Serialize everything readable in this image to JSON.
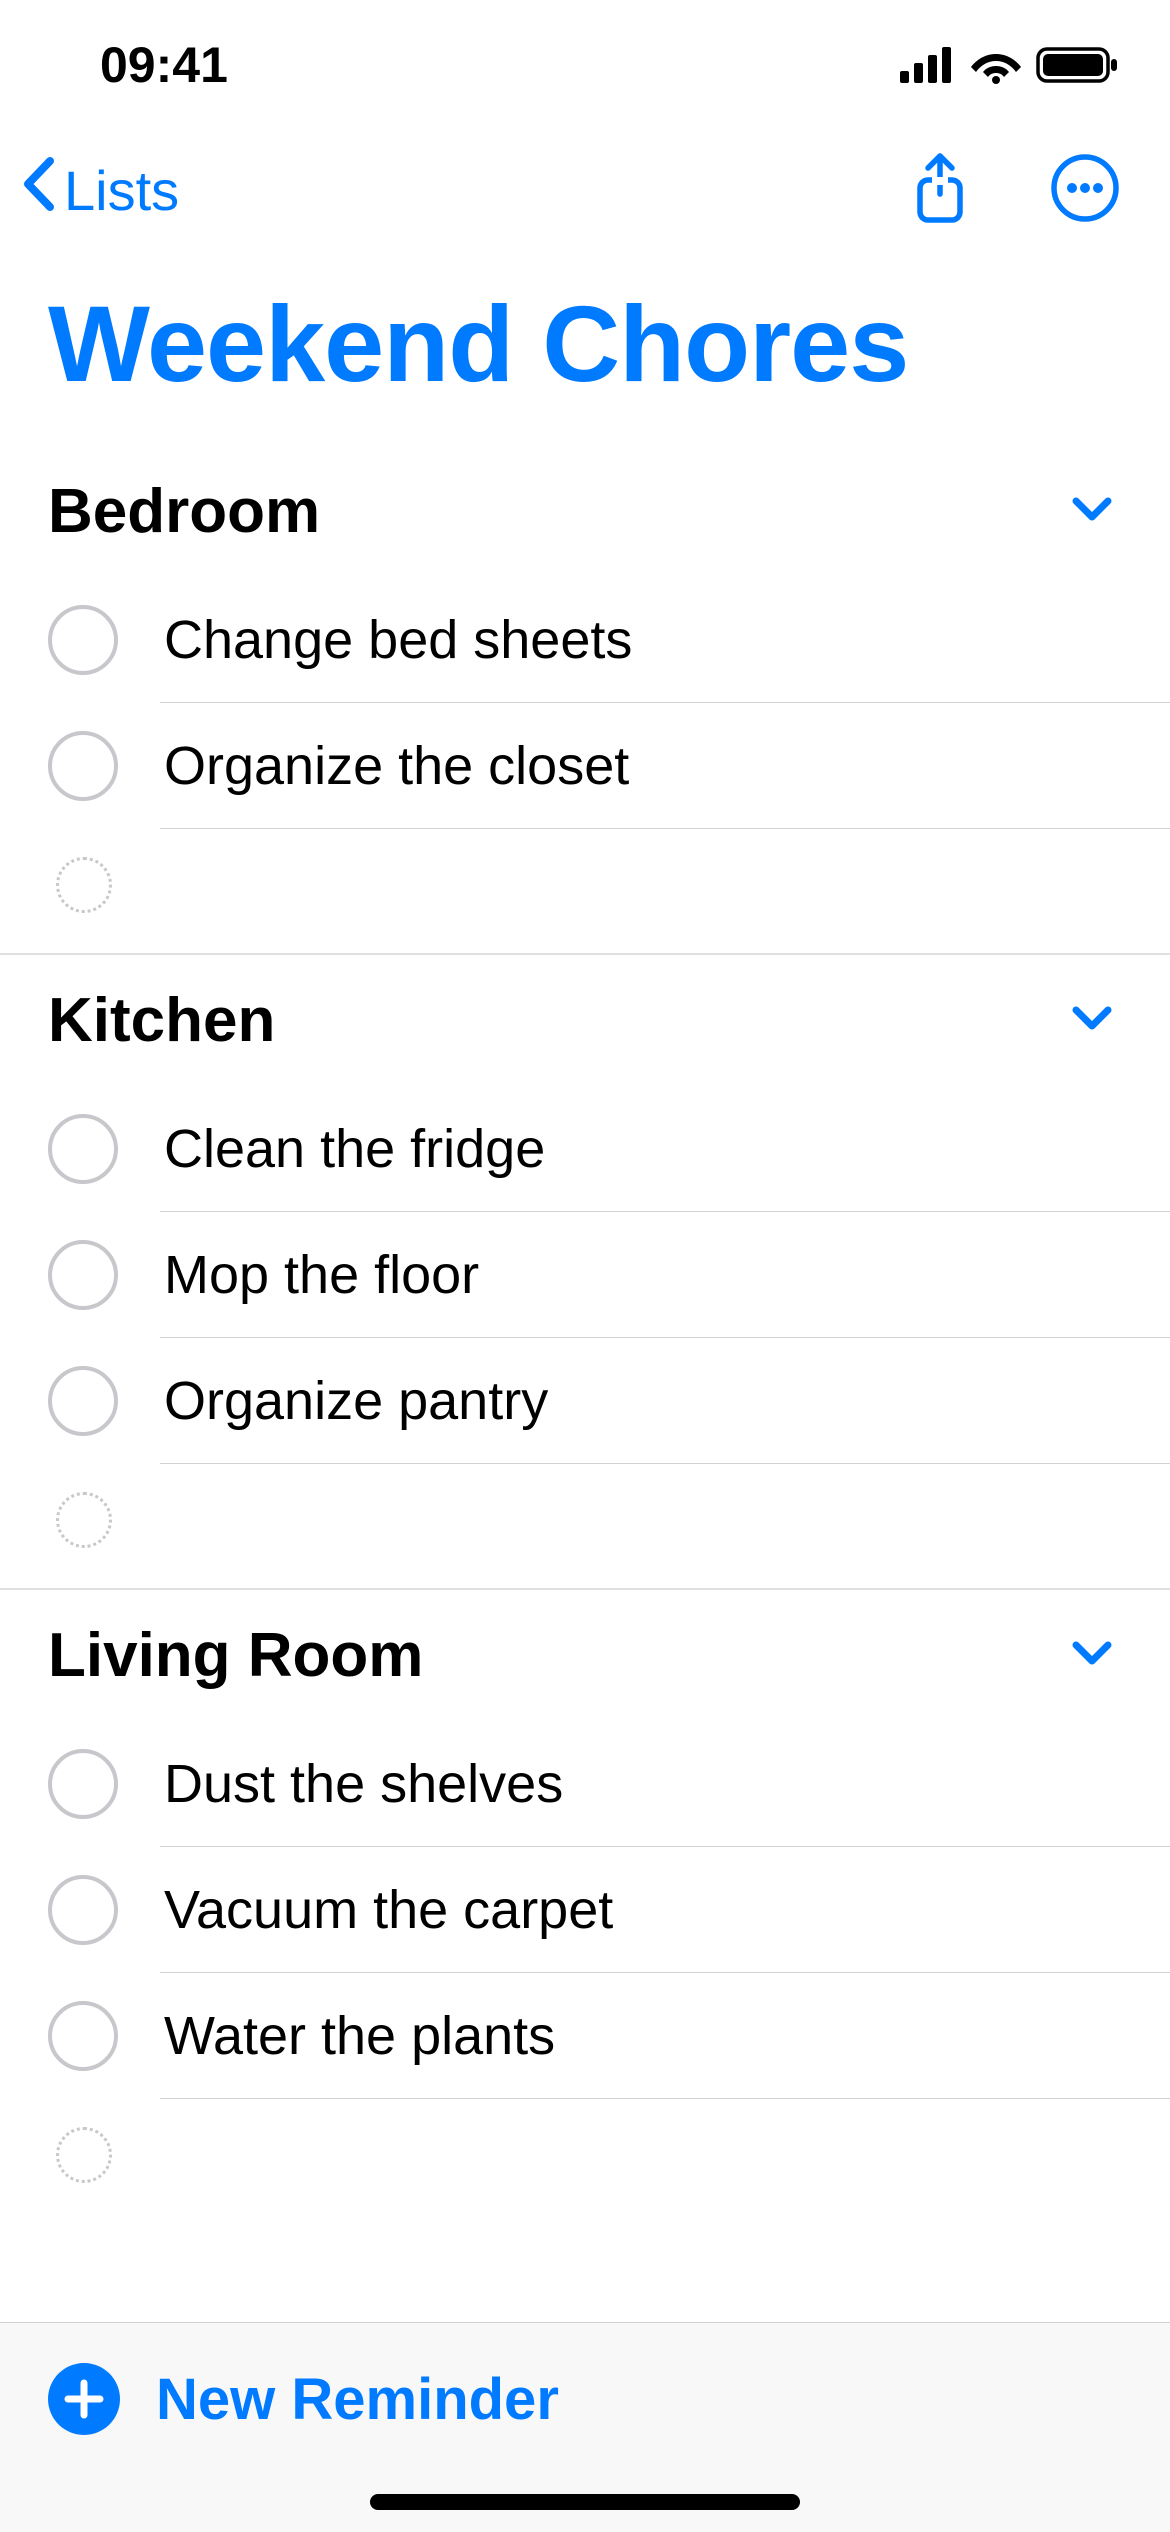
{
  "status_bar": {
    "time": "09:41"
  },
  "nav": {
    "back_label": "Lists"
  },
  "list": {
    "title": "Weekend Chores"
  },
  "sections": [
    {
      "title": "Bedroom",
      "items": [
        {
          "text": "Change bed sheets"
        },
        {
          "text": "Organize the closet"
        }
      ]
    },
    {
      "title": "Kitchen",
      "items": [
        {
          "text": "Clean the fridge"
        },
        {
          "text": "Mop the floor"
        },
        {
          "text": "Organize pantry"
        }
      ]
    },
    {
      "title": "Living Room",
      "items": [
        {
          "text": "Dust the shelves"
        },
        {
          "text": "Vacuum the carpet"
        },
        {
          "text": "Water the plants"
        }
      ]
    }
  ],
  "toolbar": {
    "new_reminder_label": "New Reminder"
  }
}
